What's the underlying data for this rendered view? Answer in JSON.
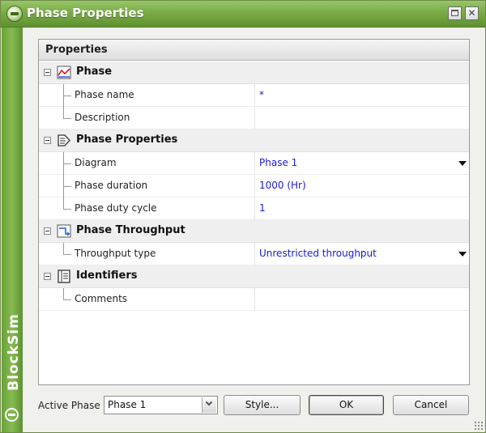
{
  "window": {
    "title": "Phase Properties",
    "brand_text": "BlockSim",
    "title_icon": "blocksim-logo-icon",
    "controls": {
      "maximize": "maximize-icon",
      "close": "✕"
    }
  },
  "grid": {
    "header": "Properties",
    "categories": [
      {
        "label": "Phase",
        "icon": "phase-chart-icon",
        "properties": [
          {
            "label": "Phase name",
            "value": "*"
          },
          {
            "label": "Description",
            "value": ""
          }
        ]
      },
      {
        "label": "Phase Properties",
        "icon": "phase-properties-icon",
        "properties": [
          {
            "label": "Diagram",
            "value": "Phase 1",
            "dropdown": true
          },
          {
            "label": "Phase duration",
            "value": "1000 (Hr)"
          },
          {
            "label": "Phase duty cycle",
            "value": "1"
          }
        ]
      },
      {
        "label": "Phase Throughput",
        "icon": "throughput-icon",
        "properties": [
          {
            "label": "Throughput type",
            "value": "Unrestricted throughput",
            "dropdown": true
          }
        ]
      },
      {
        "label": "Identifiers",
        "icon": "identifiers-icon",
        "properties": [
          {
            "label": "Comments",
            "value": ""
          }
        ]
      }
    ]
  },
  "footer": {
    "active_phase_label": "Active Phase",
    "active_phase_value": "Phase 1",
    "style_button": "Style...",
    "ok_button": "OK",
    "cancel_button": "Cancel"
  },
  "colors": {
    "title_bar": "#79ab45",
    "value_text": "#1a1ad8",
    "category_bg": "#efefef"
  }
}
